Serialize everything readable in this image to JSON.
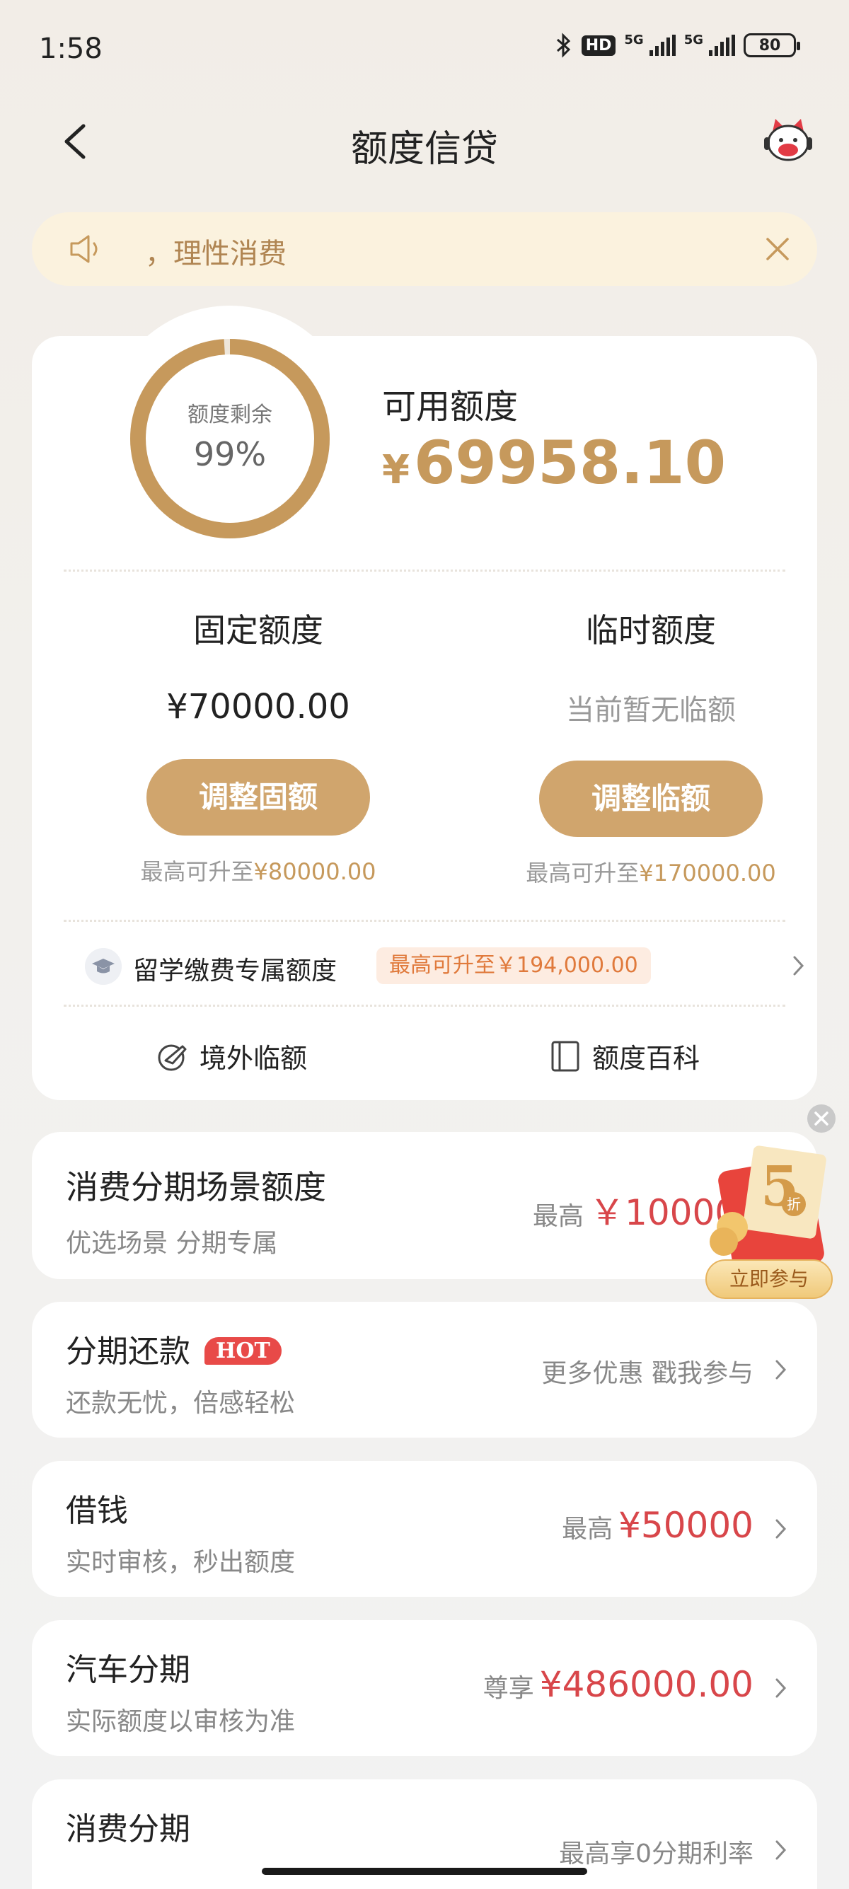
{
  "status_bar": {
    "time": "1:58",
    "hd": "HD",
    "network1": "5G",
    "network2": "5G",
    "battery": "80"
  },
  "nav": {
    "title": "额度信贷"
  },
  "notice": {
    "text": "，理性消费"
  },
  "credit": {
    "ring_label": "额度剩余",
    "ring_percent": "99%",
    "ring_fraction": 0.99,
    "available_label": "可用额度",
    "available_currency": "¥",
    "available_amount": "69958.10",
    "fixed": {
      "title": "固定额度",
      "value": "¥70000.00",
      "button": "调整固额",
      "hint_prefix": "最高可升至",
      "hint_value": "¥80000.00"
    },
    "temp": {
      "title": "临时额度",
      "value": "当前暂无临额",
      "button": "调整临额",
      "hint_prefix": "最高可升至",
      "hint_value": "¥170000.00"
    },
    "study": {
      "label": "留学缴费专属额度",
      "tag": "最高可升至￥194,000.00"
    },
    "links": {
      "overseas": "境外临额",
      "wiki": "额度百科"
    }
  },
  "rows": [
    {
      "title": "消费分期场景额度",
      "subtitle": "优选场景 分期专属",
      "right_prefix": "最高",
      "right_value": "￥100000"
    },
    {
      "title": "分期还款",
      "badge": "HOT",
      "subtitle": "还款无忧，倍感轻松",
      "right_text": "更多优惠 戳我参与"
    },
    {
      "title": "借钱",
      "subtitle": "实时审核，秒出额度",
      "right_prefix": "最高",
      "right_value": "¥50000"
    },
    {
      "title": "汽车分期",
      "subtitle": "实际额度以审核为准",
      "right_prefix": "尊享",
      "right_value": "¥486000.00"
    },
    {
      "title": "消费分期",
      "right_text": "最高享0分期利率"
    }
  ],
  "promo": {
    "discount": "5",
    "discount_unit": "折",
    "button": "立即参与"
  },
  "colors": {
    "gold": "#c6995c",
    "button_gold": "#d0a56d",
    "red": "#d8464a",
    "notice_bg": "#fbf2de"
  }
}
